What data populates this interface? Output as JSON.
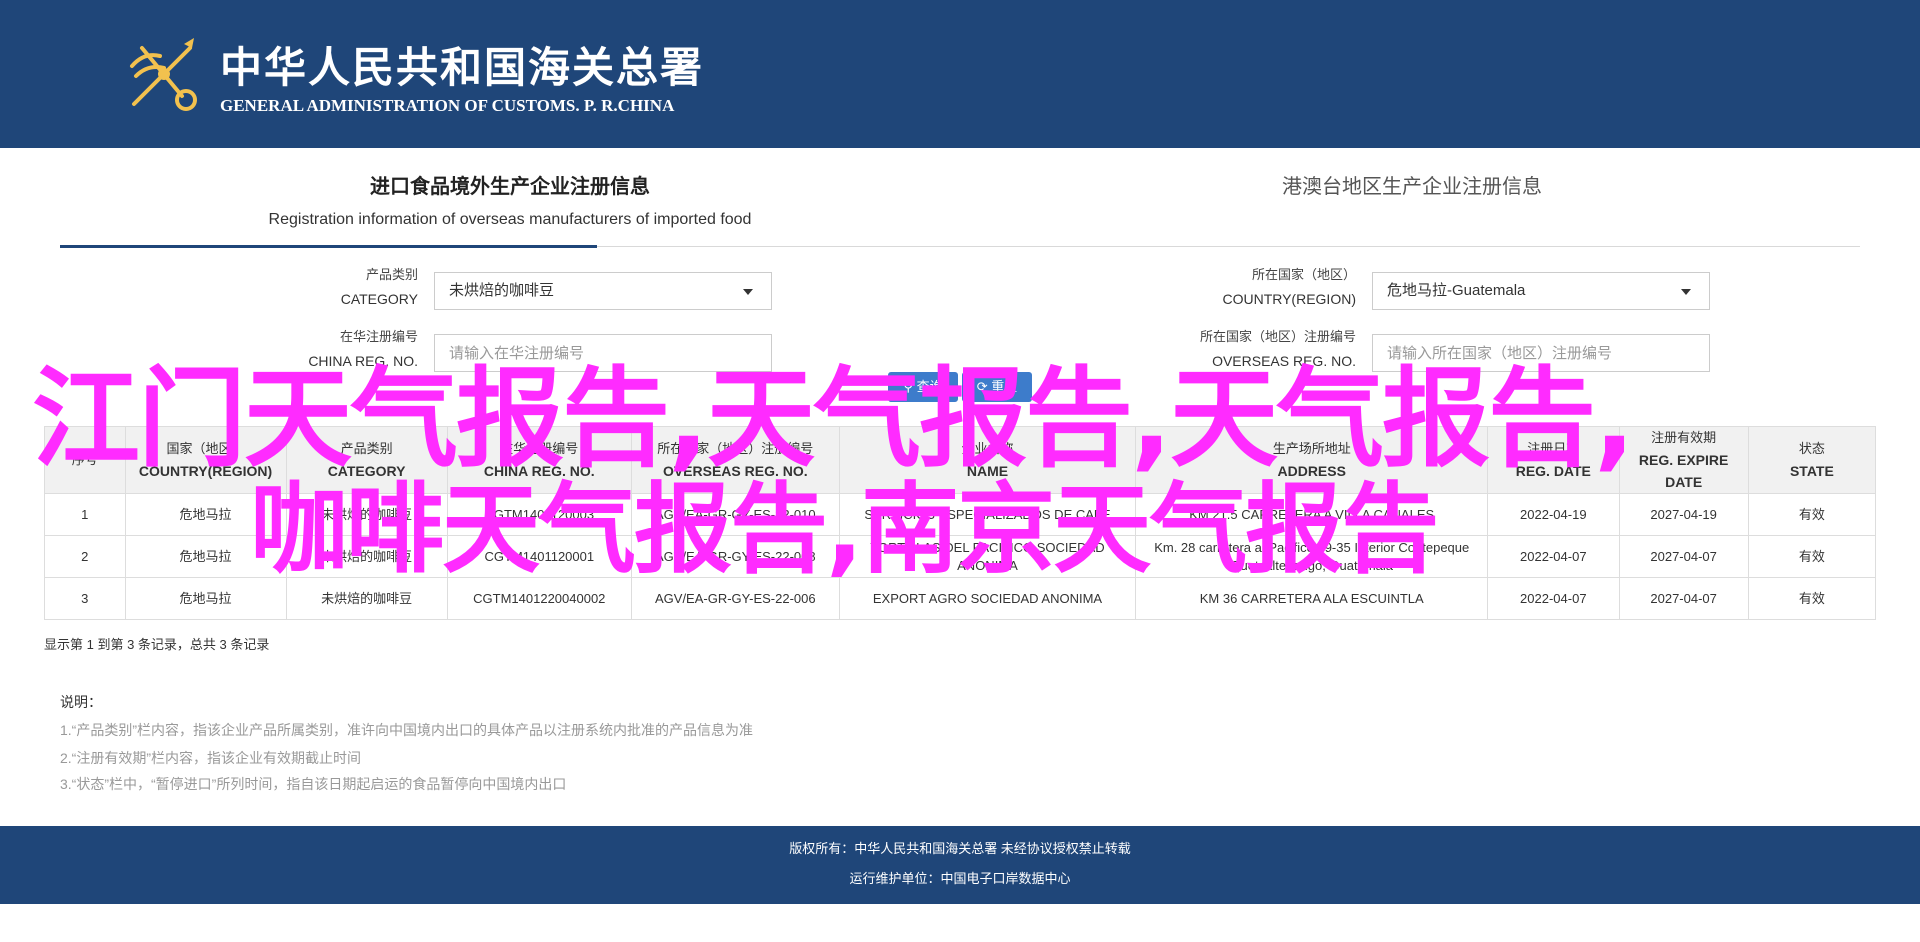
{
  "header": {
    "title_cn": "中华人民共和国海关总署",
    "title_en": "GENERAL ADMINISTRATION OF CUSTOMS. P. R.CHINA"
  },
  "tabs": [
    {
      "cn": "进口食品境外生产企业注册信息",
      "en": "Registration information of overseas manufacturers of imported food",
      "active": true
    },
    {
      "cn": "港澳台地区生产企业注册信息",
      "active": false
    }
  ],
  "form": {
    "category": {
      "label_cn": "产品类别",
      "label_en": "CATEGORY",
      "value": "未烘焙的咖啡豆"
    },
    "country": {
      "label_cn": "所在国家（地区）",
      "label_en": "COUNTRY(REGION)",
      "value": "危地马拉-Guatemala"
    },
    "china_reg": {
      "label_cn": "在华注册编号",
      "label_en": "CHINA REG. NO.",
      "placeholder": "请输入在华注册编号"
    },
    "overseas_reg": {
      "label_cn": "所在国家（地区）注册编号",
      "label_en": "OVERSEAS REG. NO.",
      "placeholder": "请输入所在国家（地区）注册编号"
    },
    "search_label": "查询",
    "reset_label": "重置"
  },
  "table": {
    "headers": [
      {
        "cn": "序号",
        "en": ""
      },
      {
        "cn": "国家（地区）",
        "en": "COUNTRY(REGION)"
      },
      {
        "cn": "产品类别",
        "en": "CATEGORY"
      },
      {
        "cn": "在华注册编号",
        "en": "CHINA REG. NO."
      },
      {
        "cn": "所在国家（地区）注册编号",
        "en": "OVERSEAS REG. NO."
      },
      {
        "cn": "企业名称",
        "en": "NAME"
      },
      {
        "cn": "生产场所地址",
        "en": "ADDRESS"
      },
      {
        "cn": "注册日期",
        "en": "REG. DATE"
      },
      {
        "cn": "注册有效期",
        "en": "REG. EXPIRE DATE"
      },
      {
        "cn": "状态",
        "en": "STATE"
      }
    ],
    "rows": [
      [
        "1",
        "危地马拉",
        "未烘焙的咖啡豆",
        "CGTM1401120003",
        "AGV/EA-GR-GY-ES-22-010",
        "SERVICIOS ESPECIALIZADOS DE CAFE",
        "KM 21.5 CARRETERA A VILLA CANALES",
        "2022-04-19",
        "2027-04-19",
        "有效"
      ],
      [
        "2",
        "危地马拉",
        "未烘焙的咖啡豆",
        "CGTM1401120001",
        "AGV/EA-GR-GY-ES-22-008",
        "TORTILLAS DEL PACIFICO SOCIEDAD ANONIMA",
        "Km. 28 carretera al Pacifico 39-35 Interior Coatepeque Quetzaltenango, Guatemala",
        "2022-04-07",
        "2027-04-07",
        "有效"
      ],
      [
        "3",
        "危地马拉",
        "未烘焙的咖啡豆",
        "CGTM1401220040002",
        "AGV/EA-GR-GY-ES-22-006",
        "EXPORT AGRO SOCIEDAD ANONIMA",
        "KM 36 CARRETERA ALA ESCUINTLA",
        "2022-04-07",
        "2027-04-07",
        "有效"
      ]
    ]
  },
  "summary": "显示第 1 到第 3 条记录，总共 3 条记录",
  "notes": {
    "title": "说明：",
    "items": [
      "1.“产品类别”栏内容，指该企业产品所属类别，准许向中国境内出口的具体产品以注册系统内批准的产品信息为准",
      "2.“注册有效期”栏内容，指该企业有效期截止时间",
      "3.“状态”栏中，“暂停进口”所列时间，指自该日期起启运的食品暂停向中国境内出口"
    ]
  },
  "footer": {
    "line1": "版权所有：中华人民共和国海关总署 未经协议授权禁止转载",
    "line2": "运行维护单位：中国电子口岸数据中心"
  },
  "overlay": {
    "line1": "江门天气报告,天气报告,天气报告,",
    "line2": "咖啡天气报告,南京天气报告"
  },
  "colors": {
    "brand": "#1f4679",
    "button": "#3d7ccb",
    "overlay": "#ff2bff"
  }
}
